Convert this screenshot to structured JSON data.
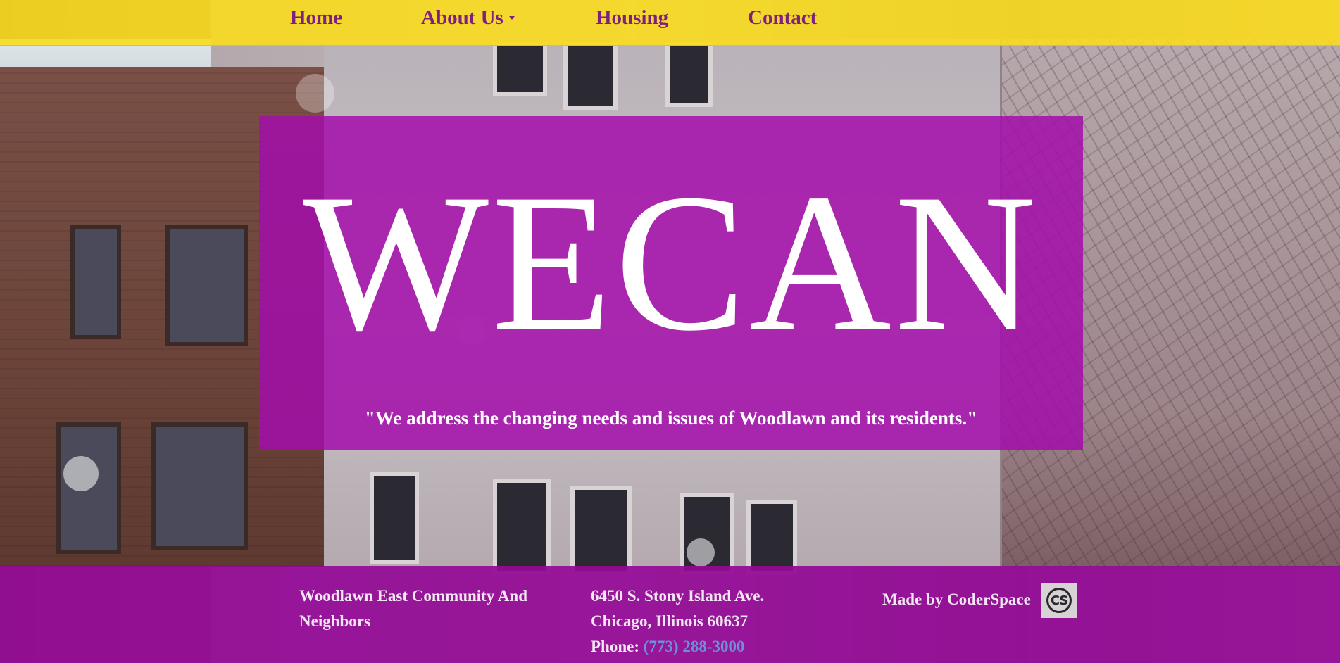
{
  "nav": {
    "items": [
      {
        "label": "Home"
      },
      {
        "label": "About Us",
        "has_dropdown": true
      },
      {
        "label": "Housing"
      },
      {
        "label": "Contact"
      }
    ]
  },
  "hero": {
    "title": "WECAN",
    "quote": "\"We address the changing needs and issues of Woodlawn and its residents.\""
  },
  "footer": {
    "org_name_line1": "Woodlawn East Community And",
    "org_name_line2": "Neighbors",
    "address_line1": "6450 S. Stony Island Ave.",
    "address_line2": "Chicago, Illinois 60637",
    "phone_label": "Phone:",
    "phone_number": "(773) 288-3000",
    "made_by": "Made by CoderSpace",
    "badge_text": "CS"
  },
  "colors": {
    "nav_bg": "#fadc1e",
    "nav_text": "#7f1f7e",
    "hero_bg": "#a30eaa",
    "footer_bg": "#930a96",
    "link": "#6f8fd6"
  },
  "icons": {
    "dropdown": "chevron-down-icon",
    "badge": "coderspace-logo-icon"
  }
}
